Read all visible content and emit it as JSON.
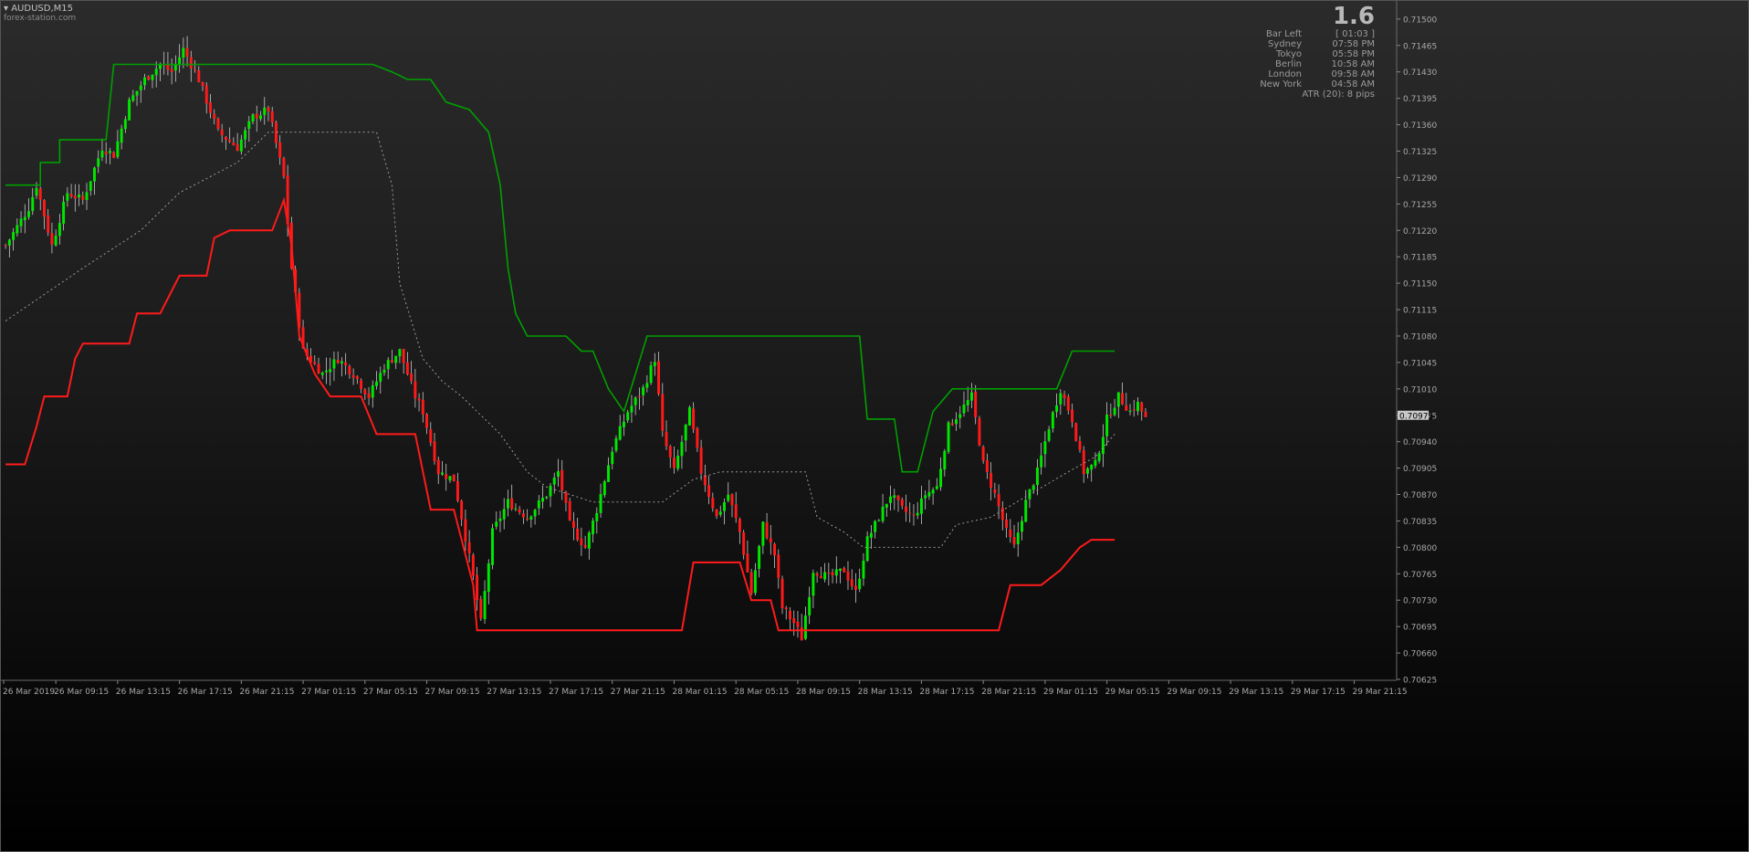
{
  "header": {
    "symbol": "AUDUSD,M15",
    "source": "forex-station.com"
  },
  "info_panel": {
    "value": "1.6",
    "rows": [
      {
        "label": "Bar Left",
        "value": "[ 01:03 ]"
      },
      {
        "label": "Sydney",
        "value": "07:58 PM"
      },
      {
        "label": "Tokyo",
        "value": "05:58 PM"
      },
      {
        "label": "Berlin",
        "value": "10:58 AM"
      },
      {
        "label": "London",
        "value": "09:58 AM"
      },
      {
        "label": "New York",
        "value": "04:58 AM"
      }
    ],
    "atr": "ATR (20): 8 pips"
  },
  "colors": {
    "bull": "#00e600",
    "bear": "#ff1a1a",
    "upper_band": "#00a000",
    "lower_band": "#ff1a1a",
    "mid": "#9a9a9a",
    "price_tag": "#c8c8c8"
  },
  "chart_data": {
    "type": "line",
    "ylim": [
      0.70625,
      0.71518
    ],
    "y_ticks": [
      "0.71500",
      "0.71465",
      "0.71430",
      "0.71395",
      "0.71360",
      "0.71325",
      "0.71290",
      "0.71255",
      "0.71220",
      "0.71185",
      "0.71150",
      "0.71115",
      "0.71080",
      "0.71045",
      "0.71010",
      "0.70975",
      "0.70940",
      "0.70905",
      "0.70870",
      "0.70835",
      "0.70800",
      "0.70765",
      "0.70730",
      "0.70695",
      "0.70660",
      "0.70625"
    ],
    "x_ticks": [
      "26 Mar 2019",
      "26 Mar 09:15",
      "26 Mar 13:15",
      "26 Mar 17:15",
      "26 Mar 21:15",
      "27 Mar 01:15",
      "27 Mar 05:15",
      "27 Mar 09:15",
      "27 Mar 13:15",
      "27 Mar 17:15",
      "27 Mar 21:15",
      "28 Mar 01:15",
      "28 Mar 05:15",
      "28 Mar 09:15",
      "28 Mar 13:15",
      "28 Mar 17:15",
      "28 Mar 21:15",
      "29 Mar 01:15",
      "29 Mar 05:15",
      "29 Mar 09:15",
      "29 Mar 13:15",
      "29 Mar 17:15",
      "29 Mar 21:15"
    ],
    "current_price": "0.70975",
    "bar_count": 296,
    "close_path": [
      [
        0,
        0.712
      ],
      [
        6,
        0.7125
      ],
      [
        8,
        0.7128
      ],
      [
        12,
        0.712
      ],
      [
        16,
        0.7127
      ],
      [
        20,
        0.7126
      ],
      [
        25,
        0.7133
      ],
      [
        28,
        0.7132
      ],
      [
        32,
        0.7139
      ],
      [
        36,
        0.7142
      ],
      [
        40,
        0.7144
      ],
      [
        43,
        0.7143
      ],
      [
        46,
        0.7146
      ],
      [
        50,
        0.7142
      ],
      [
        55,
        0.7135
      ],
      [
        60,
        0.7133
      ],
      [
        64,
        0.7137
      ],
      [
        68,
        0.7138
      ],
      [
        72,
        0.7129
      ],
      [
        74,
        0.7117
      ],
      [
        77,
        0.7106
      ],
      [
        82,
        0.7103
      ],
      [
        86,
        0.7105
      ],
      [
        90,
        0.7103
      ],
      [
        94,
        0.71
      ],
      [
        98,
        0.7104
      ],
      [
        102,
        0.7106
      ],
      [
        106,
        0.71
      ],
      [
        108,
        0.7098
      ],
      [
        112,
        0.709
      ],
      [
        116,
        0.7089
      ],
      [
        118,
        0.7084
      ],
      [
        121,
        0.7076
      ],
      [
        123,
        0.707
      ],
      [
        126,
        0.7082
      ],
      [
        130,
        0.7086
      ],
      [
        135,
        0.7084
      ],
      [
        140,
        0.7087
      ],
      [
        143,
        0.709
      ],
      [
        146,
        0.7083
      ],
      [
        150,
        0.708
      ],
      [
        153,
        0.7085
      ],
      [
        157,
        0.7093
      ],
      [
        161,
        0.7098
      ],
      [
        165,
        0.7101
      ],
      [
        168,
        0.7105
      ],
      [
        170,
        0.7095
      ],
      [
        173,
        0.709
      ],
      [
        177,
        0.7098
      ],
      [
        180,
        0.709
      ],
      [
        184,
        0.7084
      ],
      [
        187,
        0.7087
      ],
      [
        190,
        0.7082
      ],
      [
        193,
        0.7074
      ],
      [
        196,
        0.7083
      ],
      [
        199,
        0.7079
      ],
      [
        201,
        0.7072
      ],
      [
        204,
        0.707
      ],
      [
        206,
        0.7068
      ],
      [
        209,
        0.7077
      ],
      [
        213,
        0.7076
      ],
      [
        217,
        0.7077
      ],
      [
        220,
        0.7074
      ],
      [
        223,
        0.7081
      ],
      [
        226,
        0.7084
      ],
      [
        229,
        0.7087
      ],
      [
        232,
        0.7085
      ],
      [
        235,
        0.7084
      ],
      [
        238,
        0.7087
      ],
      [
        241,
        0.7088
      ],
      [
        244,
        0.7096
      ],
      [
        247,
        0.7098
      ],
      [
        250,
        0.71
      ],
      [
        253,
        0.7091
      ],
      [
        256,
        0.7087
      ],
      [
        259,
        0.7082
      ],
      [
        261,
        0.708
      ],
      [
        264,
        0.7086
      ],
      [
        267,
        0.709
      ],
      [
        270,
        0.7096
      ],
      [
        273,
        0.7101
      ],
      [
        276,
        0.7097
      ],
      [
        279,
        0.709
      ],
      [
        282,
        0.7091
      ],
      [
        285,
        0.7097
      ],
      [
        288,
        0.71
      ],
      [
        291,
        0.7098
      ],
      [
        293,
        0.7099
      ],
      [
        295,
        0.7097
      ]
    ],
    "upper_band": [
      [
        0,
        0.7128
      ],
      [
        9,
        0.7128
      ],
      [
        9,
        0.7131
      ],
      [
        14,
        0.7131
      ],
      [
        14,
        0.7134
      ],
      [
        26,
        0.7134
      ],
      [
        28,
        0.7144
      ],
      [
        40,
        0.7144
      ],
      [
        44,
        0.7144
      ],
      [
        95,
        0.7144
      ],
      [
        100,
        0.7143
      ],
      [
        104,
        0.7142
      ],
      [
        110,
        0.7142
      ],
      [
        114,
        0.7139
      ],
      [
        120,
        0.7138
      ],
      [
        125,
        0.7135
      ],
      [
        128,
        0.7128
      ],
      [
        130,
        0.7117
      ],
      [
        132,
        0.7111
      ],
      [
        135,
        0.7108
      ],
      [
        145,
        0.7108
      ],
      [
        149,
        0.7106
      ],
      [
        152,
        0.7106
      ],
      [
        156,
        0.7101
      ],
      [
        160,
        0.7098
      ],
      [
        166,
        0.7108
      ],
      [
        221,
        0.7108
      ],
      [
        223,
        0.7097
      ],
      [
        230,
        0.7097
      ],
      [
        232,
        0.709
      ],
      [
        236,
        0.709
      ],
      [
        240,
        0.7098
      ],
      [
        245,
        0.7101
      ],
      [
        266,
        0.7101
      ],
      [
        272,
        0.7101
      ],
      [
        276,
        0.7106
      ],
      [
        287,
        0.7106
      ]
    ],
    "lower_band": [
      [
        0,
        0.7091
      ],
      [
        5,
        0.7091
      ],
      [
        8,
        0.7096
      ],
      [
        10,
        0.71
      ],
      [
        16,
        0.71
      ],
      [
        18,
        0.7105
      ],
      [
        20,
        0.7107
      ],
      [
        32,
        0.7107
      ],
      [
        34,
        0.7111
      ],
      [
        40,
        0.7111
      ],
      [
        45,
        0.7116
      ],
      [
        52,
        0.7116
      ],
      [
        54,
        0.7121
      ],
      [
        58,
        0.7122
      ],
      [
        69,
        0.7122
      ],
      [
        72,
        0.7126
      ],
      [
        74,
        0.712
      ],
      [
        76,
        0.7108
      ],
      [
        80,
        0.7103
      ],
      [
        84,
        0.71
      ],
      [
        92,
        0.71
      ],
      [
        96,
        0.7095
      ],
      [
        106,
        0.7095
      ],
      [
        110,
        0.7085
      ],
      [
        116,
        0.7085
      ],
      [
        118,
        0.7081
      ],
      [
        121,
        0.7075
      ],
      [
        122,
        0.7069
      ],
      [
        175,
        0.7069
      ],
      [
        178,
        0.7078
      ],
      [
        190,
        0.7078
      ],
      [
        193,
        0.7073
      ],
      [
        198,
        0.7073
      ],
      [
        200,
        0.7069
      ],
      [
        257,
        0.7069
      ],
      [
        260,
        0.7075
      ],
      [
        265,
        0.7075
      ],
      [
        268,
        0.7075
      ],
      [
        273,
        0.7077
      ],
      [
        278,
        0.708
      ],
      [
        281,
        0.7081
      ],
      [
        287,
        0.7081
      ]
    ],
    "mid_band": [
      [
        0,
        0.711
      ],
      [
        20,
        0.7117
      ],
      [
        35,
        0.7122
      ],
      [
        45,
        0.7127
      ],
      [
        60,
        0.7131
      ],
      [
        68,
        0.7135
      ],
      [
        80,
        0.7135
      ],
      [
        96,
        0.7135
      ],
      [
        100,
        0.7128
      ],
      [
        102,
        0.7115
      ],
      [
        108,
        0.7105
      ],
      [
        113,
        0.7102
      ],
      [
        118,
        0.71
      ],
      [
        128,
        0.7095
      ],
      [
        135,
        0.709
      ],
      [
        140,
        0.7088
      ],
      [
        146,
        0.7087
      ],
      [
        152,
        0.7086
      ],
      [
        170,
        0.7086
      ],
      [
        178,
        0.7089
      ],
      [
        185,
        0.709
      ],
      [
        207,
        0.709
      ],
      [
        210,
        0.7084
      ],
      [
        217,
        0.7082
      ],
      [
        222,
        0.708
      ],
      [
        230,
        0.708
      ],
      [
        242,
        0.708
      ],
      [
        246,
        0.7083
      ],
      [
        255,
        0.7084
      ],
      [
        265,
        0.7087
      ],
      [
        275,
        0.709
      ],
      [
        282,
        0.7092
      ],
      [
        287,
        0.7095
      ]
    ]
  }
}
